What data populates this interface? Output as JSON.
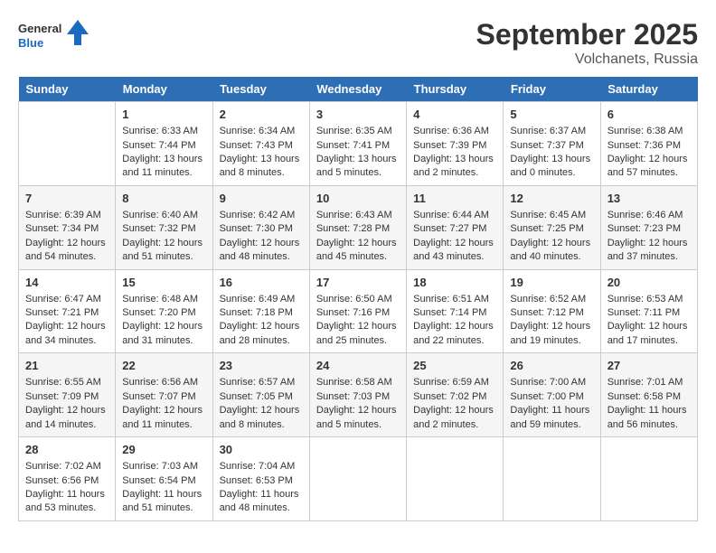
{
  "logo": {
    "line1": "General",
    "line2": "Blue"
  },
  "title": "September 2025",
  "location": "Volchanets, Russia",
  "days_of_week": [
    "Sunday",
    "Monday",
    "Tuesday",
    "Wednesday",
    "Thursday",
    "Friday",
    "Saturday"
  ],
  "weeks": [
    [
      {
        "day": "",
        "content": ""
      },
      {
        "day": "1",
        "content": "Sunrise: 6:33 AM\nSunset: 7:44 PM\nDaylight: 13 hours\nand 11 minutes."
      },
      {
        "day": "2",
        "content": "Sunrise: 6:34 AM\nSunset: 7:43 PM\nDaylight: 13 hours\nand 8 minutes."
      },
      {
        "day": "3",
        "content": "Sunrise: 6:35 AM\nSunset: 7:41 PM\nDaylight: 13 hours\nand 5 minutes."
      },
      {
        "day": "4",
        "content": "Sunrise: 6:36 AM\nSunset: 7:39 PM\nDaylight: 13 hours\nand 2 minutes."
      },
      {
        "day": "5",
        "content": "Sunrise: 6:37 AM\nSunset: 7:37 PM\nDaylight: 13 hours\nand 0 minutes."
      },
      {
        "day": "6",
        "content": "Sunrise: 6:38 AM\nSunset: 7:36 PM\nDaylight: 12 hours\nand 57 minutes."
      }
    ],
    [
      {
        "day": "7",
        "content": "Sunrise: 6:39 AM\nSunset: 7:34 PM\nDaylight: 12 hours\nand 54 minutes."
      },
      {
        "day": "8",
        "content": "Sunrise: 6:40 AM\nSunset: 7:32 PM\nDaylight: 12 hours\nand 51 minutes."
      },
      {
        "day": "9",
        "content": "Sunrise: 6:42 AM\nSunset: 7:30 PM\nDaylight: 12 hours\nand 48 minutes."
      },
      {
        "day": "10",
        "content": "Sunrise: 6:43 AM\nSunset: 7:28 PM\nDaylight: 12 hours\nand 45 minutes."
      },
      {
        "day": "11",
        "content": "Sunrise: 6:44 AM\nSunset: 7:27 PM\nDaylight: 12 hours\nand 43 minutes."
      },
      {
        "day": "12",
        "content": "Sunrise: 6:45 AM\nSunset: 7:25 PM\nDaylight: 12 hours\nand 40 minutes."
      },
      {
        "day": "13",
        "content": "Sunrise: 6:46 AM\nSunset: 7:23 PM\nDaylight: 12 hours\nand 37 minutes."
      }
    ],
    [
      {
        "day": "14",
        "content": "Sunrise: 6:47 AM\nSunset: 7:21 PM\nDaylight: 12 hours\nand 34 minutes."
      },
      {
        "day": "15",
        "content": "Sunrise: 6:48 AM\nSunset: 7:20 PM\nDaylight: 12 hours\nand 31 minutes."
      },
      {
        "day": "16",
        "content": "Sunrise: 6:49 AM\nSunset: 7:18 PM\nDaylight: 12 hours\nand 28 minutes."
      },
      {
        "day": "17",
        "content": "Sunrise: 6:50 AM\nSunset: 7:16 PM\nDaylight: 12 hours\nand 25 minutes."
      },
      {
        "day": "18",
        "content": "Sunrise: 6:51 AM\nSunset: 7:14 PM\nDaylight: 12 hours\nand 22 minutes."
      },
      {
        "day": "19",
        "content": "Sunrise: 6:52 AM\nSunset: 7:12 PM\nDaylight: 12 hours\nand 19 minutes."
      },
      {
        "day": "20",
        "content": "Sunrise: 6:53 AM\nSunset: 7:11 PM\nDaylight: 12 hours\nand 17 minutes."
      }
    ],
    [
      {
        "day": "21",
        "content": "Sunrise: 6:55 AM\nSunset: 7:09 PM\nDaylight: 12 hours\nand 14 minutes."
      },
      {
        "day": "22",
        "content": "Sunrise: 6:56 AM\nSunset: 7:07 PM\nDaylight: 12 hours\nand 11 minutes."
      },
      {
        "day": "23",
        "content": "Sunrise: 6:57 AM\nSunset: 7:05 PM\nDaylight: 12 hours\nand 8 minutes."
      },
      {
        "day": "24",
        "content": "Sunrise: 6:58 AM\nSunset: 7:03 PM\nDaylight: 12 hours\nand 5 minutes."
      },
      {
        "day": "25",
        "content": "Sunrise: 6:59 AM\nSunset: 7:02 PM\nDaylight: 12 hours\nand 2 minutes."
      },
      {
        "day": "26",
        "content": "Sunrise: 7:00 AM\nSunset: 7:00 PM\nDaylight: 11 hours\nand 59 minutes."
      },
      {
        "day": "27",
        "content": "Sunrise: 7:01 AM\nSunset: 6:58 PM\nDaylight: 11 hours\nand 56 minutes."
      }
    ],
    [
      {
        "day": "28",
        "content": "Sunrise: 7:02 AM\nSunset: 6:56 PM\nDaylight: 11 hours\nand 53 minutes."
      },
      {
        "day": "29",
        "content": "Sunrise: 7:03 AM\nSunset: 6:54 PM\nDaylight: 11 hours\nand 51 minutes."
      },
      {
        "day": "30",
        "content": "Sunrise: 7:04 AM\nSunset: 6:53 PM\nDaylight: 11 hours\nand 48 minutes."
      },
      {
        "day": "",
        "content": ""
      },
      {
        "day": "",
        "content": ""
      },
      {
        "day": "",
        "content": ""
      },
      {
        "day": "",
        "content": ""
      }
    ]
  ]
}
